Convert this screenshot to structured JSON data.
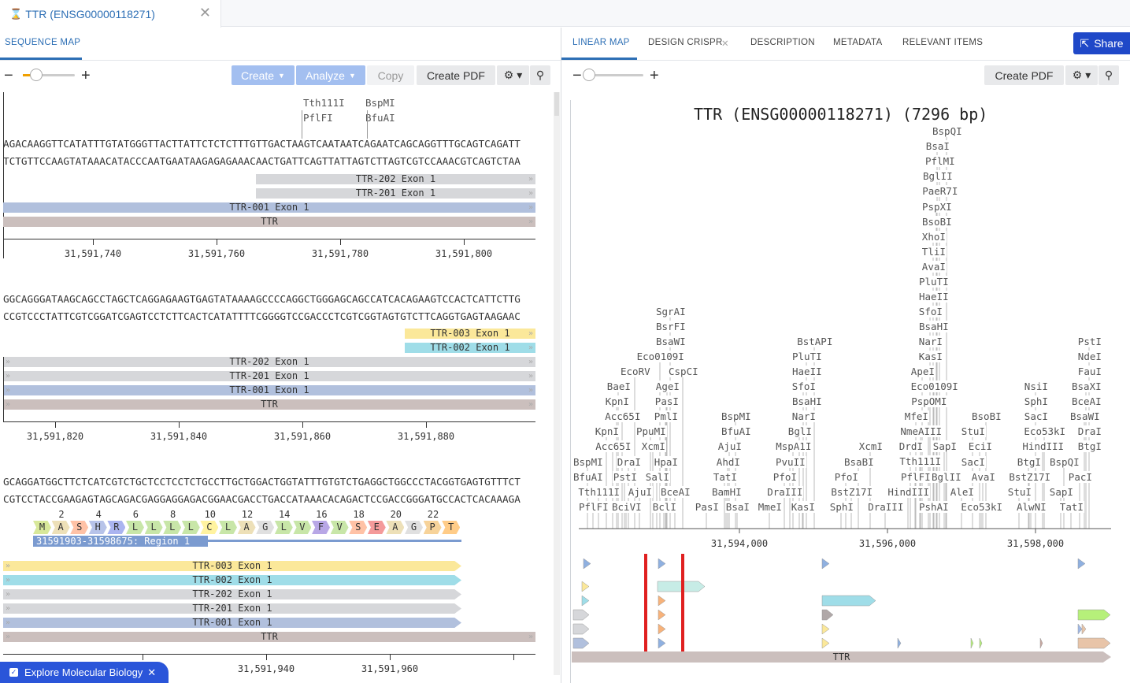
{
  "doc_tab": {
    "title": "TTR (ENSG00000118271)"
  },
  "left_tabs": {
    "sequence_map": "SEQUENCE MAP"
  },
  "right_tabs": {
    "linear_map": "LINEAR MAP",
    "design_crispr": "DESIGN CRISPR",
    "description": "DESCRIPTION",
    "metadata": "METADATA",
    "relevant_items": "RELEVANT ITEMS"
  },
  "share": "Share",
  "toolbar_left": {
    "create": "Create",
    "analyze": "Analyze",
    "copy": "Copy",
    "create_pdf": "Create PDF"
  },
  "toolbar_right": {
    "create_pdf": "Create PDF"
  },
  "explore": "Explore Molecular Biology",
  "rows": [
    {
      "enzymes": [
        "Tth111I",
        "PflFI",
        "BspMI",
        "BfuAI"
      ],
      "top": "AGACAAGGTTCATATTTGTATGGGTTACTTATTCTCTCTTTGTTGACTAAGTCAATAATCAGAATCAGCAGGTTTGCAGTCAGATT",
      "bottom": "TCTGTTCCAAGTATAAACATACCCAATGAATAAGAGAGAAACAACTGATTCAGTTATTAGTCTTAGTCGTCCAAACGTCAGTCTAA",
      "features": [
        "TTR-202 Exon 1",
        "TTR-201 Exon 1",
        "TTR-001 Exon 1",
        "TTR"
      ],
      "ticks": [
        "31,591,740",
        "31,591,760",
        "31,591,780",
        "31,591,800"
      ]
    },
    {
      "top": "GGCAGGGATAAGCAGCCTAGCTCAGGAGAAGTGAGTATAAAAGCCCCAGGCTGGGAGCAGCCATCACAGAAGTCCACTCATTCTTG",
      "bottom": "CCGTCCCTATTCGTCGGATCGAGTCCTCTTCACTCATATTTTCGGGGTCCGACCCTCGTCGGTAGTGTCTTCAGGTGAGTAAGAAC",
      "features": [
        "TTR-003 Exon 1",
        "TTR-002 Exon 1",
        "TTR-202 Exon 1",
        "TTR-201 Exon 1",
        "TTR-001 Exon 1",
        "TTR"
      ],
      "ticks": [
        "31,591,820",
        "31,591,840",
        "31,591,860",
        "31,591,880"
      ]
    },
    {
      "top": "GCAGGATGGCTTCTCATCGTCTGCTCCTCCTCTGCCTTGCTGGACTGGTATTTGTGTCTGAGGCTGGCCCTACGGTGAGTGTTTCT",
      "bottom": "CGTCCTACCGAAGAGTAGCAGACGAGGAGGAGACGGAACGACCTGACCATAAACACAGACTCCGACCGGGATGCCACTCACAAAGA",
      "aa_numbers": [
        "2",
        "4",
        "6",
        "8",
        "10",
        "12",
        "14",
        "16",
        "18",
        "20",
        "22"
      ],
      "amino_acids": [
        "M",
        "A",
        "S",
        "H",
        "R",
        "L",
        "L",
        "L",
        "L",
        "C",
        "L",
        "A",
        "G",
        "L",
        "V",
        "F",
        "V",
        "S",
        "E",
        "A",
        "G",
        "P",
        "T"
      ],
      "region": "31591903-31598675: Region 1",
      "features": [
        "TTR-003 Exon 1",
        "TTR-002 Exon 1",
        "TTR-202 Exon 1",
        "TTR-201 Exon 1",
        "TTR-001 Exon 1",
        "TTR"
      ],
      "ticks": [
        "31,591,940",
        "31,591,960"
      ]
    }
  ],
  "linear_map": {
    "title": "TTR (ENSG00000118271) (7296 bp)",
    "axis_ticks": [
      "31,594,000",
      "31,596,000",
      "31,598,000"
    ],
    "track_label": "TTR",
    "enzymes": [
      [
        "BspQI",
        1202,
        168
      ],
      [
        "BsaI",
        1190,
        187
      ],
      [
        "PflMI",
        1193,
        206
      ],
      [
        "BglII",
        1190,
        225
      ],
      [
        "PaeR7I",
        1193,
        244
      ],
      [
        "PspXI",
        1189,
        264
      ],
      [
        "BsoBI",
        1189,
        283
      ],
      [
        "XhoI",
        1185,
        302
      ],
      [
        "TliI",
        1185,
        321
      ],
      [
        "AvaI",
        1185,
        340
      ],
      [
        "PluTI",
        1185,
        359
      ],
      [
        "HaeII",
        1185,
        378
      ],
      [
        "SfoI",
        1181,
        397
      ],
      [
        "BsaHI",
        1185,
        416
      ],
      [
        "NarI",
        1181,
        435
      ],
      [
        "KasI",
        1181,
        454
      ],
      [
        "ApeI",
        1171,
        473
      ],
      [
        "Eco0109I",
        1186,
        492
      ],
      [
        "PspOMI",
        1179,
        511
      ],
      [
        "MfeI",
        1163,
        530
      ],
      [
        "NmeAIII",
        1169,
        549
      ],
      [
        "DrdI",
        1156,
        568
      ],
      [
        "Tth111I",
        1168,
        587
      ],
      [
        "PflFI",
        1162,
        607
      ],
      [
        "HindIII",
        1153,
        626
      ],
      [
        "PshAI",
        1185,
        645
      ],
      [
        "BglII",
        1201,
        607
      ],
      [
        "SapI",
        1199,
        568
      ],
      [
        "StuI",
        1235,
        549
      ],
      [
        "BsoBI",
        1252,
        530
      ],
      [
        "SacI",
        1235,
        588
      ],
      [
        "EciI",
        1244,
        568
      ],
      [
        "AvaI",
        1248,
        607
      ],
      [
        "AleI",
        1221,
        626
      ],
      [
        "Eco53kI",
        1246,
        645
      ],
      [
        "SgrAI",
        851,
        397
      ],
      [
        "BsrFI",
        851,
        416
      ],
      [
        "BsaWI",
        851,
        435
      ],
      [
        "Eco0109I",
        838,
        454
      ],
      [
        "EcoRV",
        806,
        473
      ],
      [
        "CspCI",
        867,
        473
      ],
      [
        "BaeI",
        785,
        492
      ],
      [
        "AgeI",
        847,
        492
      ],
      [
        "KpnI",
        783,
        511
      ],
      [
        "PasI",
        846,
        511
      ],
      [
        "Acc65I",
        790,
        530
      ],
      [
        "PmlI",
        845,
        530
      ],
      [
        "KpnI",
        770,
        549
      ],
      [
        "PpuMI",
        826,
        549
      ],
      [
        "Acc65I",
        778,
        568
      ],
      [
        "XcmI",
        829,
        568
      ],
      [
        "BspMI",
        746,
        588
      ],
      [
        "DraI",
        798,
        588
      ],
      [
        "HpaI",
        845,
        588
      ],
      [
        "BfuAI",
        746,
        607
      ],
      [
        "PstI",
        793,
        607
      ],
      [
        "SalI",
        834,
        607
      ],
      [
        "Tth111I",
        760,
        626
      ],
      [
        "AjuI",
        812,
        626
      ],
      [
        "BceAI",
        857,
        626
      ],
      [
        "PflFI",
        753,
        645
      ],
      [
        "BciVI",
        795,
        645
      ],
      [
        "BclI",
        843,
        645
      ],
      [
        "BspMI",
        934,
        530
      ],
      [
        "BfuAI",
        934,
        549
      ],
      [
        "AjuI",
        926,
        568
      ],
      [
        "AhdI",
        924,
        588
      ],
      [
        "TatI",
        920,
        607
      ],
      [
        "BamHI",
        922,
        626
      ],
      [
        "PasI",
        897,
        645
      ],
      [
        "BsaI",
        936,
        645
      ],
      [
        "MmeI",
        977,
        645
      ],
      [
        "BstAPI",
        1034,
        435
      ],
      [
        "PluTI",
        1024,
        454
      ],
      [
        "HaeII",
        1024,
        473
      ],
      [
        "SfoI",
        1020,
        492
      ],
      [
        "BsaHI",
        1024,
        511
      ],
      [
        "NarI",
        1020,
        530
      ],
      [
        "BglI",
        1015,
        549
      ],
      [
        "MspA1I",
        1007,
        568
      ],
      [
        "PvuII",
        1003,
        588
      ],
      [
        "PfoI",
        996,
        607
      ],
      [
        "DraIII",
        996,
        626
      ],
      [
        "KasI",
        1019,
        645
      ],
      [
        "XcmI",
        1105,
        568
      ],
      [
        "BsaBI",
        1090,
        588
      ],
      [
        "PfoI",
        1074,
        607
      ],
      [
        "BstZ17I",
        1081,
        626
      ],
      [
        "SphI",
        1068,
        645
      ],
      [
        "DraIII",
        1124,
        645
      ],
      [
        "PstI",
        1383,
        435
      ],
      [
        "NdeI",
        1383,
        454
      ],
      [
        "FauI",
        1383,
        473
      ],
      [
        "NsiI",
        1315,
        492
      ],
      [
        "BsaXI",
        1379,
        492
      ],
      [
        "SphI",
        1315,
        511
      ],
      [
        "BceAI",
        1379,
        511
      ],
      [
        "SacI",
        1315,
        530
      ],
      [
        "BsaWI",
        1377,
        530
      ],
      [
        "Eco53kI",
        1326,
        549
      ],
      [
        "DraI",
        1383,
        549
      ],
      [
        "HindIII",
        1324,
        568
      ],
      [
        "BtgI",
        1383,
        568
      ],
      [
        "BtgI",
        1306,
        588
      ],
      [
        "BspQI",
        1351,
        588
      ],
      [
        "BstZ17I",
        1307,
        607
      ],
      [
        "PacI",
        1371,
        607
      ],
      [
        "StuI",
        1294,
        626
      ],
      [
        "SapI",
        1347,
        626
      ],
      [
        "AlwNI",
        1309,
        645
      ],
      [
        "TatI",
        1360,
        645
      ]
    ]
  },
  "colors": {
    "accent": "#2d6fb5",
    "share": "#1f48c8",
    "ttr": "#cbbfbd",
    "exon001": "#b1c0dd",
    "exon201": "#d6d7da",
    "exon002": "#9fdde8",
    "exon003": "#fbe89a",
    "cut": "#e02020"
  }
}
